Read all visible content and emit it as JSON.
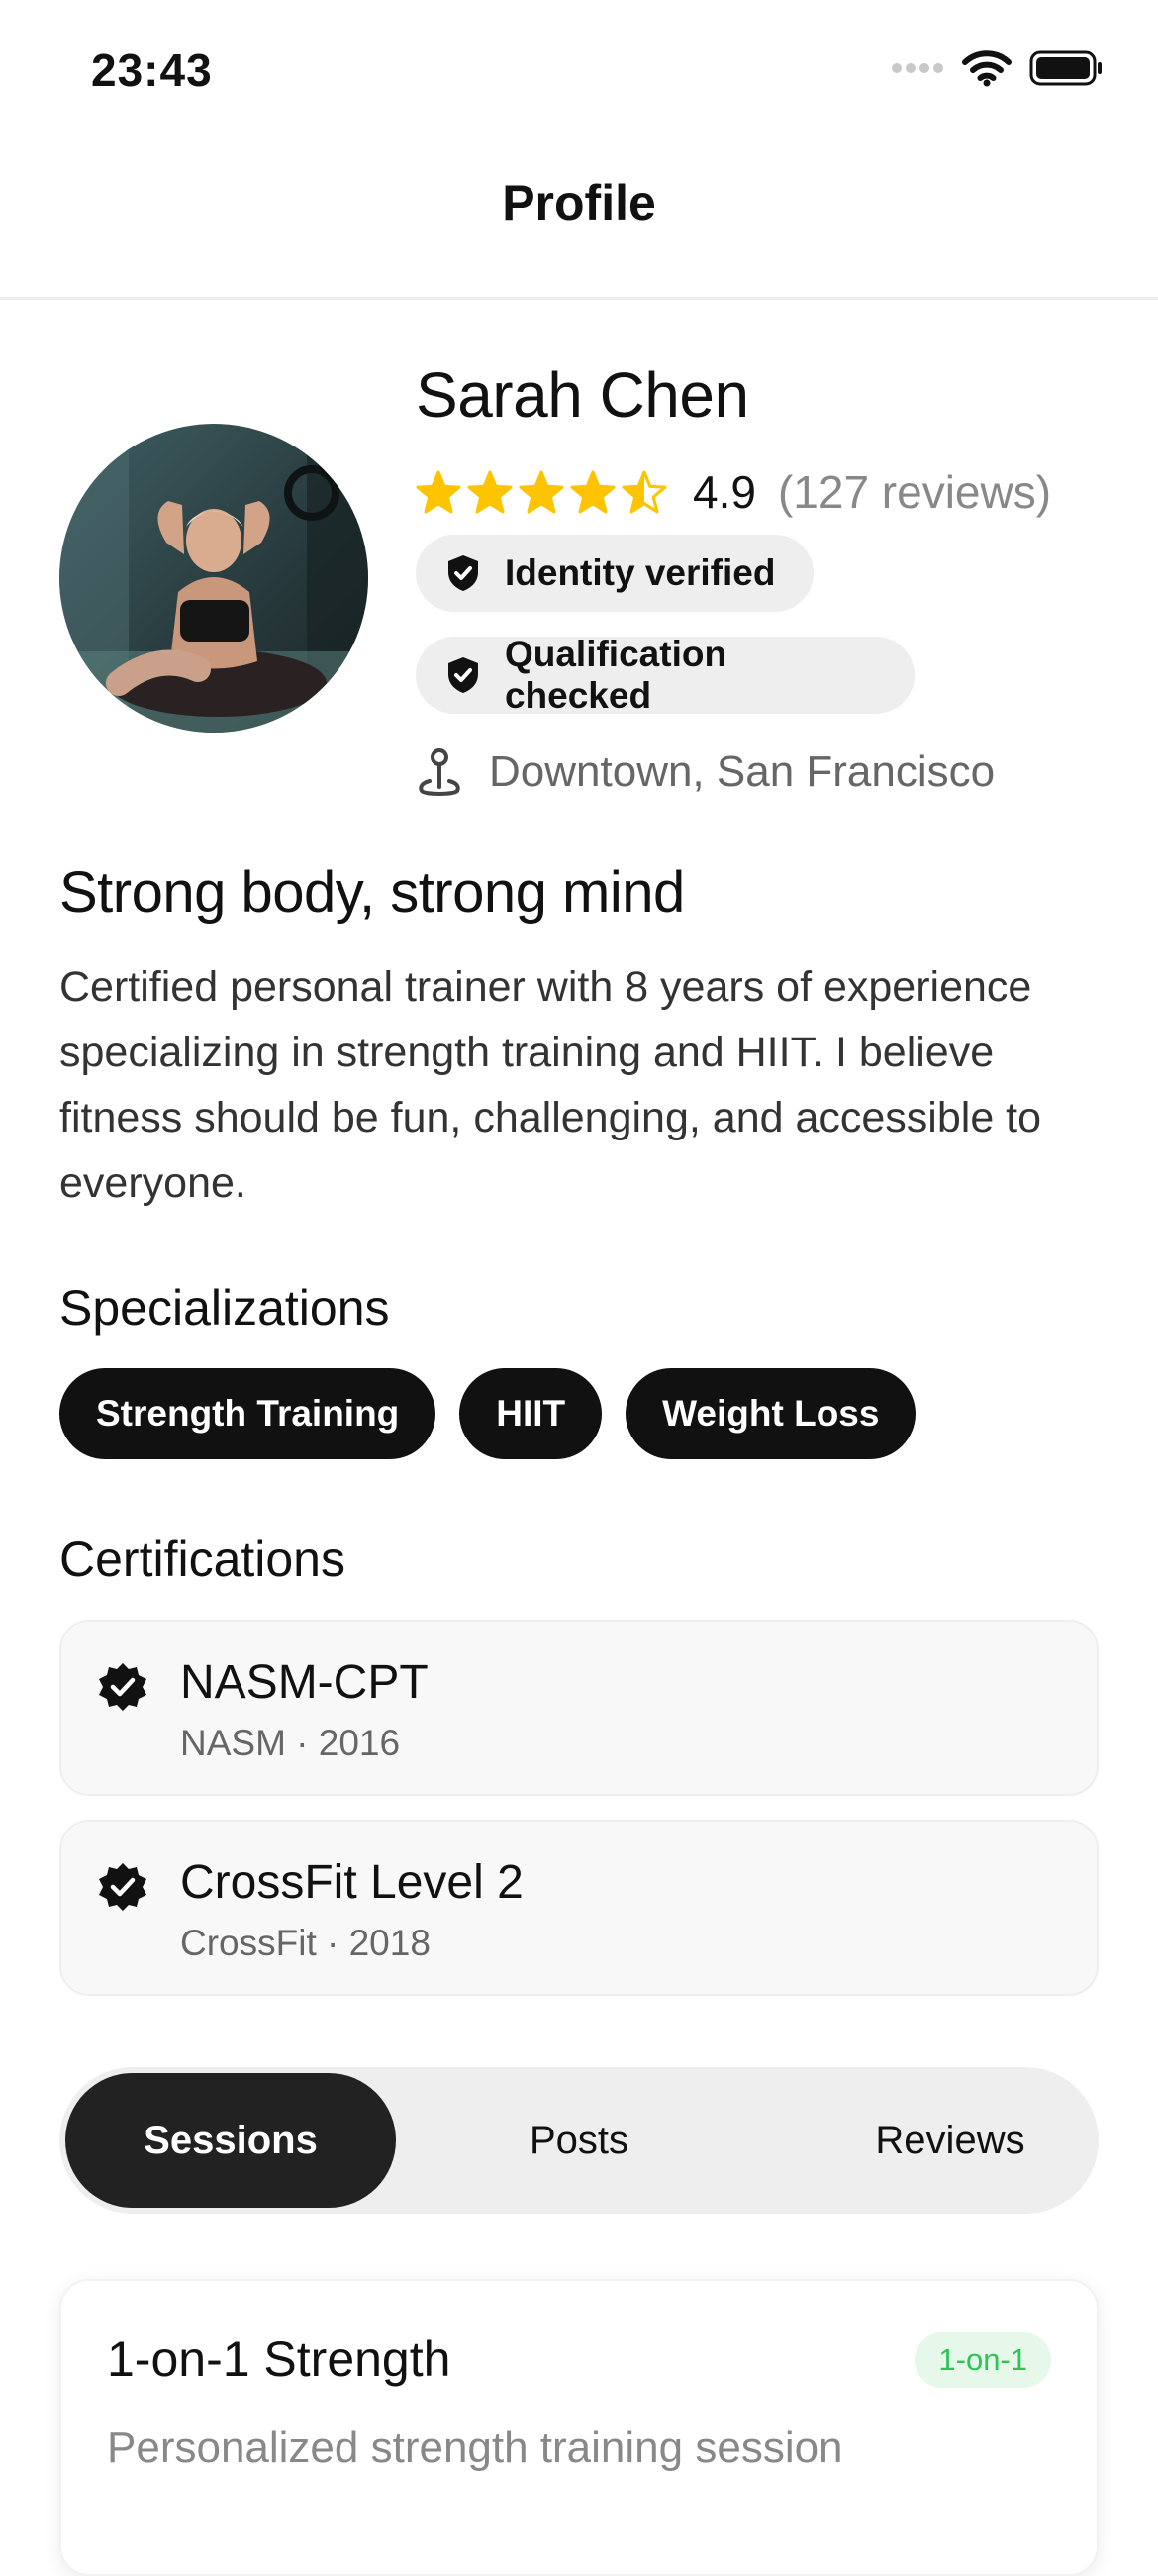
{
  "status_bar": {
    "time": "23:43"
  },
  "header": {
    "title": "Profile"
  },
  "profile": {
    "name": "Sarah Chen",
    "rating": "4.9",
    "rating_stars": 4.5,
    "reviews_count": "(127 reviews)",
    "badges": [
      {
        "label": "Identity verified",
        "icon": "shield-check-icon"
      },
      {
        "label": "Qualification checked",
        "icon": "shield-check-icon"
      }
    ],
    "location": "Downtown, San Francisco"
  },
  "about": {
    "tagline": "Strong body, strong mind",
    "bio": "Certified personal trainer with 8 years of experience specializing in strength training and HIIT. I believe fitness should be fun, challenging, and accessible to everyone."
  },
  "specializations": {
    "title": "Specializations",
    "items": [
      "Strength Training",
      "HIIT",
      "Weight Loss"
    ]
  },
  "certifications": {
    "title": "Certifications",
    "items": [
      {
        "name": "NASM-CPT",
        "meta": "NASM · 2016"
      },
      {
        "name": "CrossFit Level 2",
        "meta": "CrossFit · 2018"
      }
    ]
  },
  "tabs": {
    "items": [
      "Sessions",
      "Posts",
      "Reviews"
    ],
    "active": "Sessions"
  },
  "sessions": [
    {
      "title": "1-on-1 Strength",
      "tag": "1-on-1",
      "description": "Personalized strength training session"
    }
  ],
  "colors": {
    "star": "#FFC400",
    "chip_bg": "#111111",
    "badge_bg": "#EEEEEE",
    "tag_green": "#2EC357",
    "tag_green_bg": "#E6F8EA"
  }
}
